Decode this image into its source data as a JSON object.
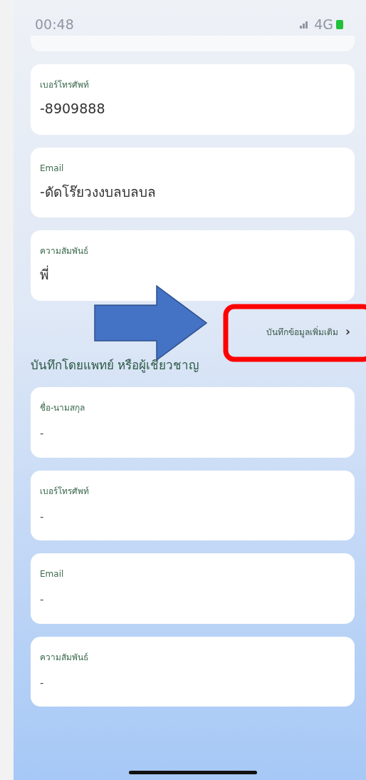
{
  "status_bar": {
    "time": "00:48",
    "network": "4G"
  },
  "contact_fields": [
    {
      "label": "เบอร์โทรศัพท์",
      "value": "-8909888"
    },
    {
      "label": "Email",
      "value": "-ดัดโร๊ยวงงบลบลบล"
    },
    {
      "label": "ความสัมพันธ์",
      "value": "พี่"
    }
  ],
  "more_link": {
    "label": "บันทึกข้อมูลเพิ่มเติม",
    "chevron": "›"
  },
  "doctor_section": {
    "title": "บันทึกโดยแพทย์ หรือผู้เชี่ยวชาญ",
    "fields": [
      {
        "label": "ชื่อ-นามสกุล",
        "value": "-"
      },
      {
        "label": "เบอร์โทรศัพท์",
        "value": "-"
      },
      {
        "label": "Email",
        "value": "-"
      },
      {
        "label": "ความสัมพันธ์",
        "value": "-"
      }
    ]
  },
  "annotations": [
    {
      "kind": "arrow",
      "color": "#4472c4"
    },
    {
      "kind": "highlight",
      "color": "#ff0000"
    }
  ]
}
